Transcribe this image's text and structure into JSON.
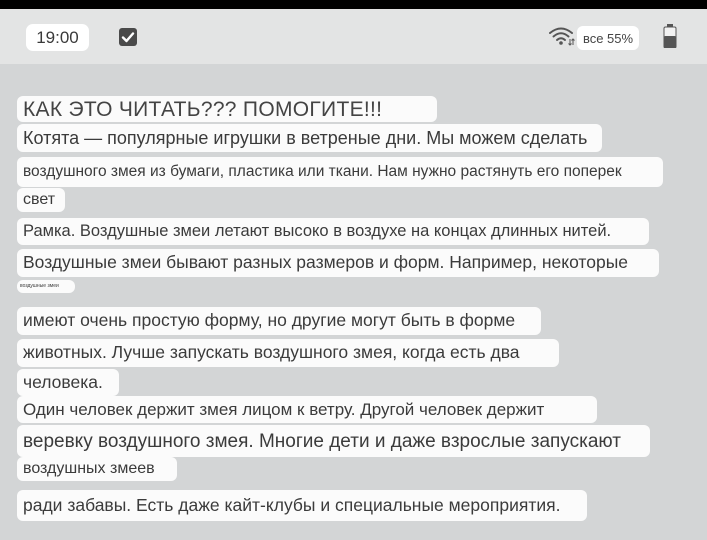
{
  "status_bar": {
    "time": "19:00",
    "battery_text": "все 55%",
    "icons": [
      "check-icon",
      "wifi-icon",
      "battery-icon"
    ]
  },
  "text_lines": [
    "КАК ЭТО ЧИТАТЬ??? ПОМОГИТЕ!!!",
    "Котята — популярные игрушки в ветреные дни. Мы можем сделать",
    "воздушного змея из бумаги, пластика или ткани. Нам нужно растянуть его поперек",
    "свет",
    "Рамка. Воздушные змеи летают высоко в воздухе на концах длинных нитей.",
    "Воздушные змеи бывают разных размеров и форм. Например, некоторые",
    "воздушные змеи",
    "имеют очень простую форму, но другие могут быть в форме",
    "животных. Лучше запускать воздушного змея, когда есть два",
    "человека.",
    "Один человек держит змея лицом к ветру. Другой человек держит",
    "веревку воздушного змея. Многие дети и даже взрослые запускают",
    "воздушных змеев",
    "ради забавы. Есть даже кайт-клубы и специальные мероприятия."
  ]
}
